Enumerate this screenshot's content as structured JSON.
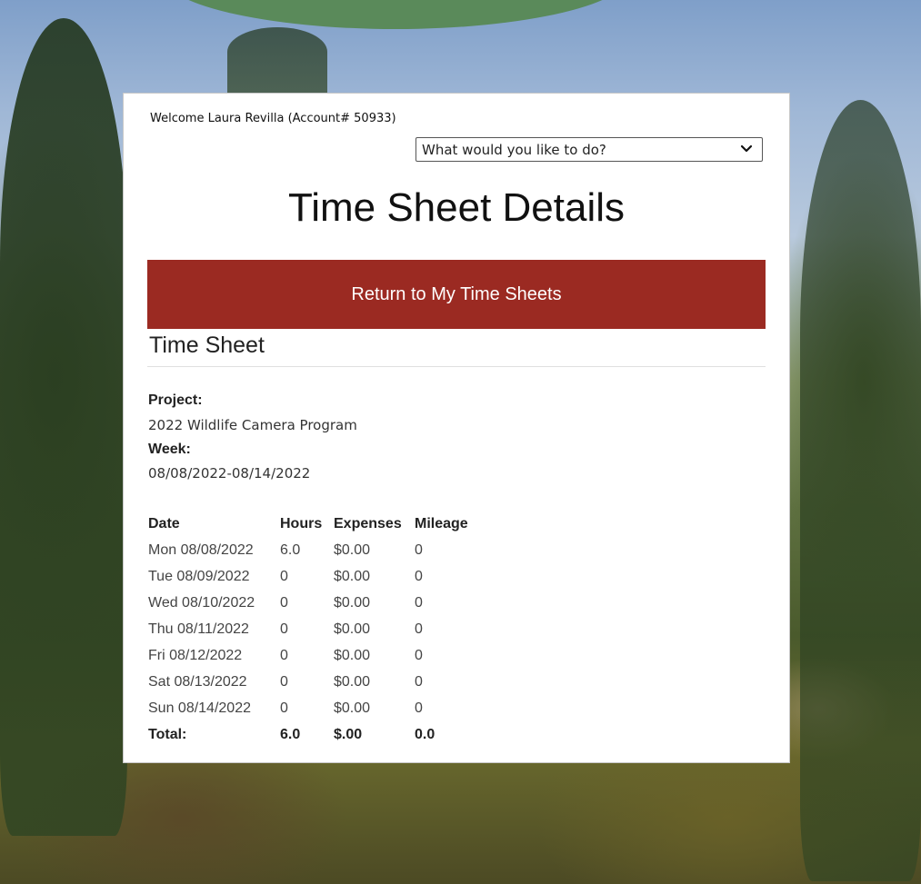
{
  "header": {
    "welcome_text": "Welcome Laura Revilla (Account# 50933)",
    "action_select": {
      "selected": "What would you like to do?",
      "icon": "chevron-down-icon"
    }
  },
  "page": {
    "title": "Time Sheet Details",
    "return_button_label": "Return to My Time Sheets",
    "section_heading": "Time Sheet"
  },
  "details": {
    "project_label": "Project:",
    "project_value": "2022 Wildlife Camera Program",
    "week_label": "Week:",
    "week_value": "08/08/2022-08/14/2022"
  },
  "table": {
    "headers": [
      "Date",
      "Hours",
      "Expenses",
      "Mileage"
    ],
    "rows": [
      {
        "date": "Mon 08/08/2022",
        "hours": "6.0",
        "expenses": "$0.00",
        "mileage": "0"
      },
      {
        "date": "Tue 08/09/2022",
        "hours": "0",
        "expenses": "$0.00",
        "mileage": "0"
      },
      {
        "date": "Wed 08/10/2022",
        "hours": "0",
        "expenses": "$0.00",
        "mileage": "0"
      },
      {
        "date": "Thu 08/11/2022",
        "hours": "0",
        "expenses": "$0.00",
        "mileage": "0"
      },
      {
        "date": "Fri 08/12/2022",
        "hours": "0",
        "expenses": "$0.00",
        "mileage": "0"
      },
      {
        "date": "Sat 08/13/2022",
        "hours": "0",
        "expenses": "$0.00",
        "mileage": "0"
      },
      {
        "date": "Sun 08/14/2022",
        "hours": "0",
        "expenses": "$0.00",
        "mileage": "0"
      }
    ],
    "total": {
      "label": "Total:",
      "hours": "6.0",
      "expenses": "$.00",
      "mileage": "0.0"
    }
  },
  "colors": {
    "return_button_bg": "#9b2a22",
    "card_bg": "#ffffff",
    "header_arc": "#5a8a5a"
  }
}
